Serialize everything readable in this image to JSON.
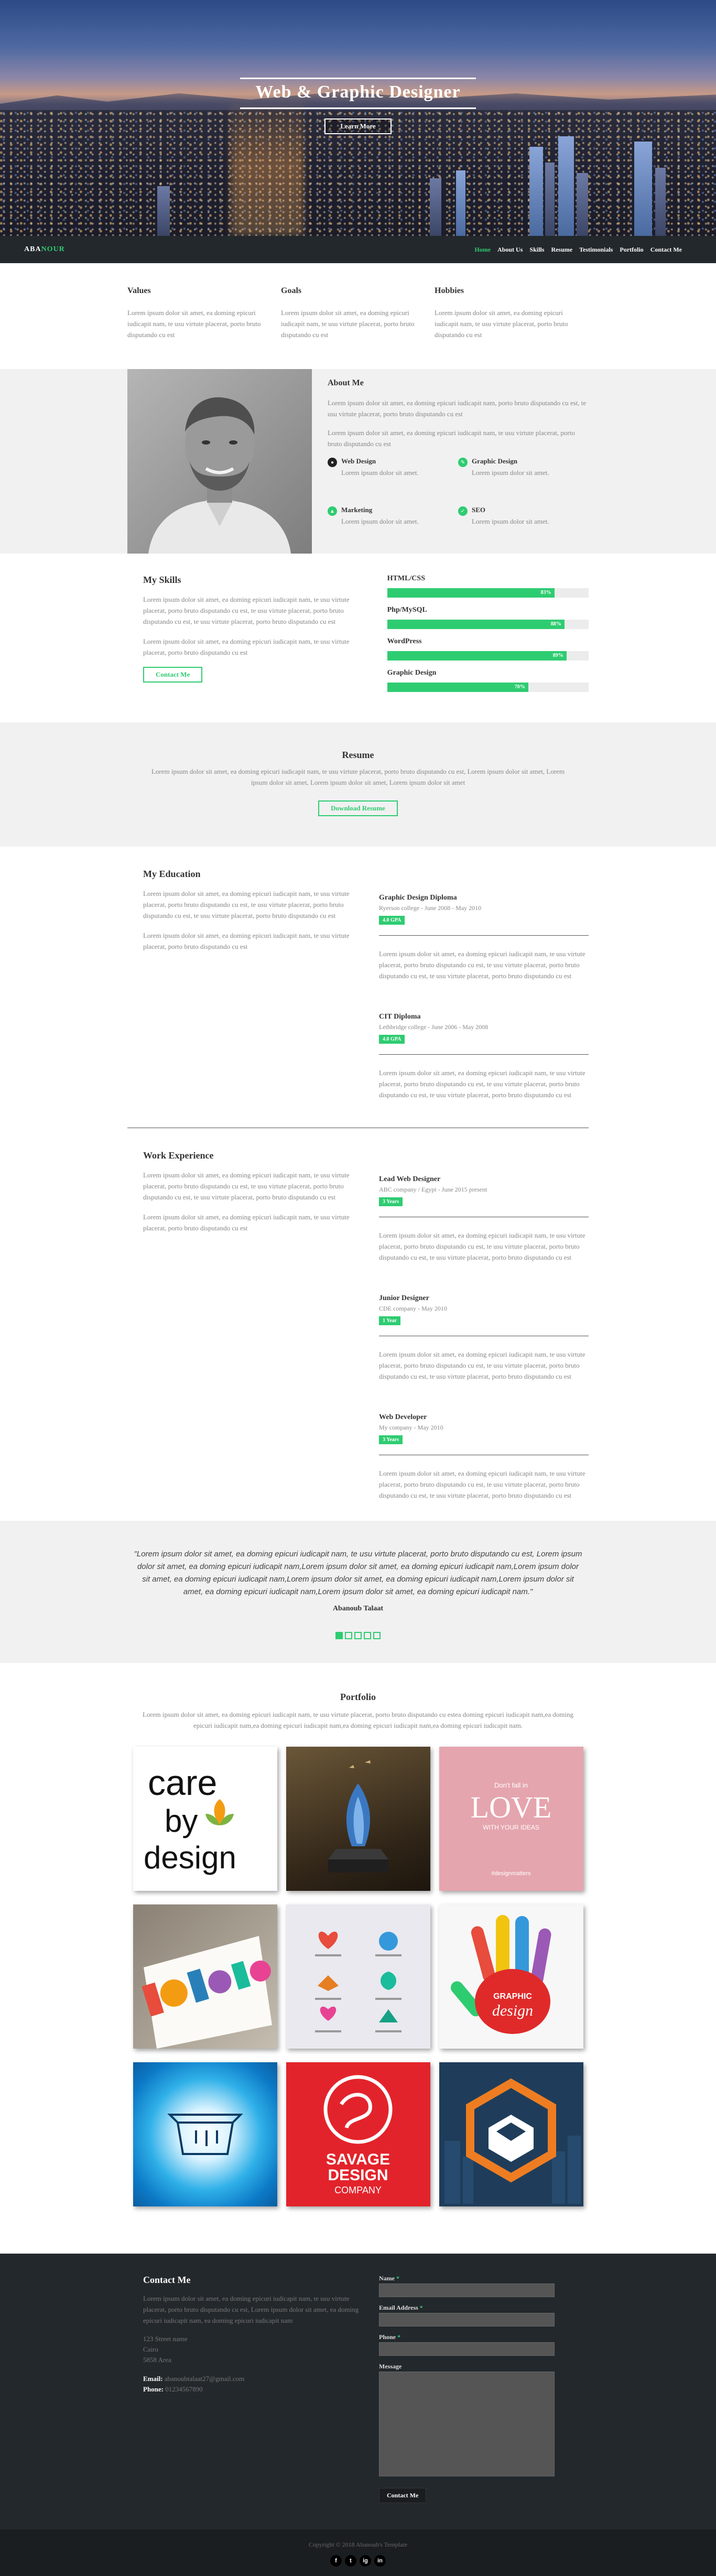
{
  "hero": {
    "title": "Web & Graphic Designer",
    "button": "Learn More"
  },
  "nav": {
    "brand_part1": "ABA",
    "brand_part2": "NOUR",
    "items": [
      "Home",
      "About Us",
      "Skills",
      "Resume",
      "Testimonials",
      "Portfolio",
      "Contact Me"
    ],
    "active": "Home"
  },
  "vgh": [
    {
      "title": "Values",
      "text": "Lorem ipsum dolor sit amet, ea doming epicuri iudicapit nam, te usu virtute placerat, porto bruto disputando cu est"
    },
    {
      "title": "Goals",
      "text": "Lorem ipsum dolor sit amet, ea doming epicuri iudicapit nam, te usu virtute placerat, porto bruto disputando cu est"
    },
    {
      "title": "Hobbies",
      "text": "Lorem ipsum dolor sit amet, ea doming epicuri iudicapit nam, te usu virtute placerat, porto bruto disputando cu est"
    }
  ],
  "about": {
    "title": "About Me",
    "p1": "Lorem ipsum dolor sit amet, ea doming epicuri iudicapit nam, porto bruto disputando cu est, te usu virtute placerat, porto bruto disputando cu est",
    "p2": "Lorem ipsum dolor sit amet, ea doming epicuri iudicapit nam, te usu virtute placerat, porto bruto disputando cu est",
    "services": [
      {
        "title": "Web Design",
        "text": "Lorem ipsum dolor sit amet.",
        "icon": "globe-icon",
        "color": "#222222"
      },
      {
        "title": "Graphic Design",
        "text": "Lorem ipsum dolor sit amet.",
        "icon": "brush-icon",
        "color": "#2ecc71"
      },
      {
        "title": "Marketing",
        "text": "Lorem ipsum dolor sit amet.",
        "icon": "chart-icon",
        "color": "#2ecc71"
      },
      {
        "title": "SEO",
        "text": "Lorem ipsum dolor sit amet.",
        "icon": "check-icon",
        "color": "#2ecc71"
      }
    ]
  },
  "skills": {
    "title": "My Skills",
    "p1": "Lorem ipsum dolor sit amet, ea doming epicuri iudicapit nam, te usu virtute placerat, porto bruto disputando cu est, te usu virtute placerat, porto bruto disputando cu est, te usu virtute placerat, porto bruto disputando cu est",
    "p2": "Lorem ipsum dolor sit amet, ea doming epicuri iudicapit nam, te usu virtute placerat, porto bruto disputando cu est",
    "button": "Contact Me",
    "bars": [
      {
        "label": "HTML/CSS",
        "percent": 83,
        "text": "83%"
      },
      {
        "label": "Php/MySQL",
        "percent": 88,
        "text": "88%"
      },
      {
        "label": "WordPress",
        "percent": 89,
        "text": "89%"
      },
      {
        "label": "Graphic Design",
        "percent": 70,
        "text": "70%"
      }
    ]
  },
  "resume": {
    "title": "Resume",
    "text": "Lorem ipsum dolor sit amet, ea doming epicuri iudicapit nam, te usu virtute placerat, porto bruto disputando cu est, Lorem ipsum dolor sit amet, Lorem ipsum dolor sit amet, Lorem ipsum dolor sit amet, Lorem ipsum dolor sit amet",
    "button": "Download Resume"
  },
  "education": {
    "title": "My Education",
    "p1": "Lorem ipsum dolor sit amet, ea doming epicuri iudicapit nam, te usu virtute placerat, porto bruto disputando cu est, te usu virtute placerat, porto bruto disputando cu est, te usu virtute placerat, porto bruto disputando cu est",
    "p2": "Lorem ipsum dolor sit amet, ea doming epicuri iudicapit nam, te usu virtute placerat, porto bruto disputando cu est",
    "entries": [
      {
        "title": "Graphic Design Diploma",
        "sub": "Ryerson college - June 2008 - May 2010",
        "badge": "4.0 GPA",
        "text": "Lorem ipsum dolor sit amet, ea doming epicuri iudicapit nam, te usu virtute placerat, porto bruto disputando cu est, te usu virtute placerat, porto bruto disputando cu est, te usu virtute placerat, porto bruto disputando cu est"
      },
      {
        "title": "CIT Diploma",
        "sub": "Lethbridge college - June 2006 - May 2008",
        "badge": "4.0 GPA",
        "text": "Lorem ipsum dolor sit amet, ea doming epicuri iudicapit nam, te usu virtute placerat, porto bruto disputando cu est, te usu virtute placerat, porto bruto disputando cu est, te usu virtute placerat, porto bruto disputando cu est"
      }
    ]
  },
  "work": {
    "title": "Work Experience",
    "p1": "Lorem ipsum dolor sit amet, ea doming epicuri iudicapit nam, te usu virtute placerat, porto bruto disputando cu est, te usu virtute placerat, porto bruto disputando cu est, te usu virtute placerat, porto bruto disputando cu est",
    "p2": "Lorem ipsum dolor sit amet, ea doming epicuri iudicapit nam, te usu virtute placerat, porto bruto disputando cu est",
    "entries": [
      {
        "title": "Lead Web Designer",
        "sub": "ABC company / Egypt - June 2015 present",
        "badge": "3 Years",
        "text": "Lorem ipsum dolor sit amet, ea doming epicuri iudicapit nam, te usu virtute placerat, porto bruto disputando cu est, te usu virtute placerat, porto bruto disputando cu est, te usu virtute placerat, porto bruto disputando cu est"
      },
      {
        "title": "Junior Designer",
        "sub": "CDE company - May 2010",
        "badge": "1 Year",
        "text": "Lorem ipsum dolor sit amet, ea doming epicuri iudicapit nam, te usu virtute placerat, porto bruto disputando cu est, te usu virtute placerat, porto bruto disputando cu est, te usu virtute placerat, porto bruto disputando cu est"
      },
      {
        "title": "Web Developer",
        "sub": "My company - May 2010",
        "badge": "3 Years",
        "text": "Lorem ipsum dolor sit amet, ea doming epicuri iudicapit nam, te usu virtute placerat, porto bruto disputando cu est, te usu virtute placerat, porto bruto disputando cu est, te usu virtute placerat, porto bruto disputando cu est"
      }
    ]
  },
  "testimonial": {
    "quote": "\"Lorem ipsum dolor sit amet, ea doming epicuri iudicapit nam, te usu virtute placerat, porto bruto disputando cu est, Lorem ipsum dolor sit amet, ea doming epicuri iudicapit nam,Lorem ipsum dolor sit amet, ea doming epicuri iudicapit nam,Lorem ipsum dolor sit amet, ea doming epicuri iudicapit nam,Lorem ipsum dolor sit amet, ea doming epicuri iudicapit nam,Lorem ipsum dolor sit amet, ea doming epicuri iudicapit nam,Lorem ipsum dolor sit amet, ea doming epicuri iudicapit nam.\"",
    "author": "Abanoub Talaat",
    "active_dot": 0,
    "dot_count": 5
  },
  "portfolio": {
    "title": "Portfolio",
    "text": "Lorem ipsum dolor sit amet, ea doming epicuri iudicapit nam, te usu virtute placerat, porto bruto disputando cu estea doming epicuri iudicapit nam,ea doming epicuri iudicapit nam,ea doming epicuri iudicapit nam,ea doming epicuri iudicapit nam,ea doming epicuri iudicapit nam.",
    "tiles": {
      "care_line1": "care",
      "care_line2": "by",
      "care_line3": "design",
      "love_small1": "Don't fall in",
      "love_big": "LOVE",
      "love_small2": "WITH YOUR IDEAS",
      "love_tag": "#designmatters",
      "hand_text1": "GRAPHIC",
      "hand_text2": "design",
      "savage1": "SAVAGE",
      "savage2": "DESIGN",
      "savage3": "COMPANY"
    }
  },
  "contact": {
    "title": "Contact Me",
    "text": "Lorem ipsum dolor sit amet, ea doming epicuri iudicapit nam, te usu virtute placerat, porto bruto disputando cu est, Lorem ipsum dolor sit amet, ea doming epicuri iudicapit nam, ea doming epicuri iudicapit nam",
    "address": [
      "123 Street name",
      "Cairo",
      "5858 Area"
    ],
    "email_label": "Email:",
    "email": "abanoubtalaat27@gmail.com",
    "phone_label": "Phone:",
    "phone": "01234567890",
    "form": {
      "name_label": "Name",
      "email_label": "Email Address",
      "phone_label": "Phone",
      "message_label": "Message",
      "submit": "Contact Me"
    }
  },
  "footer": {
    "copyright": "Copyright © 2018 Abanoub's Template",
    "social": [
      "f",
      "t",
      "ig",
      "in"
    ]
  }
}
